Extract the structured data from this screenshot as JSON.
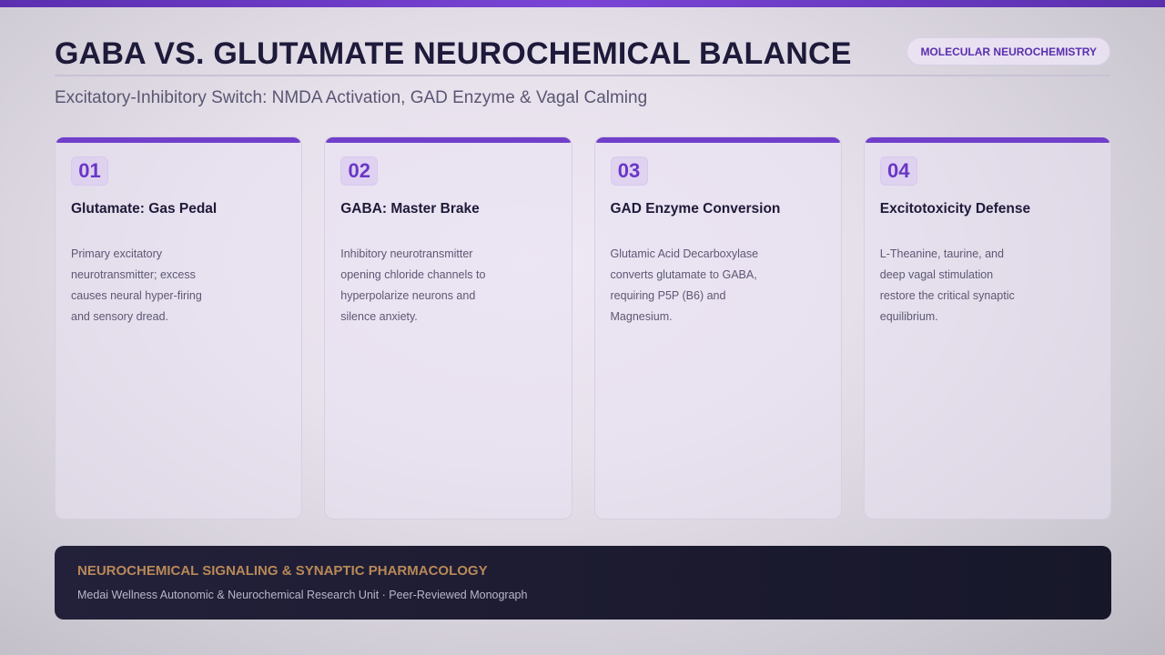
{
  "header": {
    "title": "GABA VS. GLUTAMATE NEUROCHEMICAL BALANCE",
    "subtitle": "Excitatory-Inhibitory Switch: NMDA Activation, GAD Enzyme & Vagal Calming",
    "badge": "MOLECULAR NEUROCHEMISTRY"
  },
  "cards": [
    {
      "number": "01",
      "title": "Glutamate: Gas Pedal",
      "description": "Primary excitatory neurotransmitter; excess causes neural hyper-firing and sensory dread."
    },
    {
      "number": "02",
      "title": "GABA: Master Brake",
      "description": "Inhibitory neurotransmitter opening chloride channels to hyperpolarize neurons and silence anxiety."
    },
    {
      "number": "03",
      "title": "GAD Enzyme Conversion",
      "description": "Glutamic Acid Decarboxylase converts glutamate to GABA, requiring P5P (B6) and Magnesium."
    },
    {
      "number": "04",
      "title": "Excitotoxicity Defense",
      "description": "L-Theanine, taurine, and deep vagal stimulation restore the critical synaptic equilibrium."
    }
  ],
  "footer": {
    "title": "NEUROCHEMICAL SIGNALING & SYNAPTIC PHARMACOLOGY",
    "subtitle": "Medai Wellness Autonomic & Neurochemical Research Unit · Peer-Reviewed Monograph"
  },
  "colors": {
    "accent": "#7140cb",
    "title_text": "#1e1a38",
    "footer_bg": "#1c1b30",
    "footer_title": "#b88958"
  }
}
